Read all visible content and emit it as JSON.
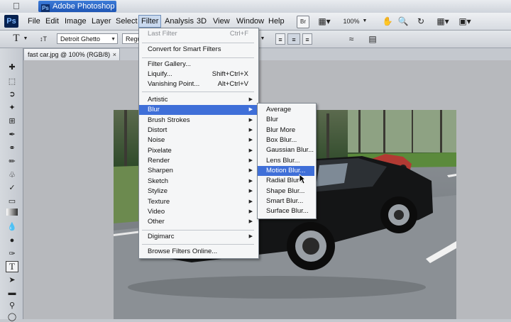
{
  "app": {
    "window_title": "Adobe Photoshop C...",
    "logo": "Ps"
  },
  "menubar": {
    "items": [
      "File",
      "Edit",
      "Image",
      "Layer",
      "Select",
      "Filter",
      "Analysis",
      "3D",
      "View",
      "Window",
      "Help"
    ],
    "active": "Filter",
    "bridge_label": "Br",
    "zoom": "100%"
  },
  "options_bar": {
    "tool_glyph": "T",
    "font_family": "Detroit Ghetto",
    "font_style": "Regu"
  },
  "document": {
    "tab_title": "fast car.jpg @ 100% (RGB/8)"
  },
  "filter_menu": {
    "items": [
      {
        "label": "Last Filter",
        "shortcut": "Ctrl+F",
        "disabled": true
      },
      {
        "label": "Convert for Smart Filters"
      },
      {
        "label": "Filter Gallery..."
      },
      {
        "label": "Liquify...",
        "shortcut": "Shift+Ctrl+X"
      },
      {
        "label": "Vanishing Point...",
        "shortcut": "Alt+Ctrl+V"
      },
      {
        "label": "Artistic",
        "submenu": true
      },
      {
        "label": "Blur",
        "submenu": true,
        "highlighted": true
      },
      {
        "label": "Brush Strokes",
        "submenu": true
      },
      {
        "label": "Distort",
        "submenu": true
      },
      {
        "label": "Noise",
        "submenu": true
      },
      {
        "label": "Pixelate",
        "submenu": true
      },
      {
        "label": "Render",
        "submenu": true
      },
      {
        "label": "Sharpen",
        "submenu": true
      },
      {
        "label": "Sketch",
        "submenu": true
      },
      {
        "label": "Stylize",
        "submenu": true
      },
      {
        "label": "Texture",
        "submenu": true
      },
      {
        "label": "Video",
        "submenu": true
      },
      {
        "label": "Other",
        "submenu": true
      },
      {
        "label": "Digimarc",
        "submenu": true
      },
      {
        "label": "Browse Filters Online..."
      }
    ]
  },
  "blur_submenu": {
    "items": [
      {
        "label": "Average"
      },
      {
        "label": "Blur"
      },
      {
        "label": "Blur More"
      },
      {
        "label": "Box Blur..."
      },
      {
        "label": "Gaussian Blur..."
      },
      {
        "label": "Lens Blur..."
      },
      {
        "label": "Motion Blur...",
        "highlighted": true
      },
      {
        "label": "Radial Blur..."
      },
      {
        "label": "Shape Blur..."
      },
      {
        "label": "Smart Blur..."
      },
      {
        "label": "Surface Blur..."
      }
    ]
  },
  "colors": {
    "highlight": "#3f6fd8",
    "menubar": "#e4e7eb",
    "canvas": "#b7b9bd"
  }
}
